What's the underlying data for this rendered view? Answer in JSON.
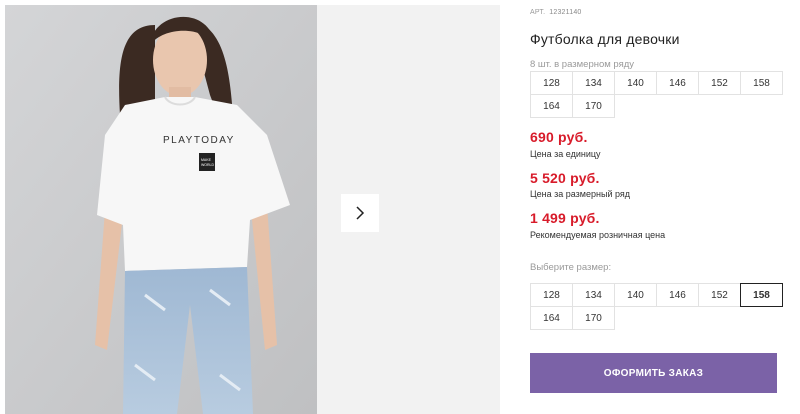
{
  "gallery": {
    "photo_alt": "product-photo",
    "shirt_print_text": "PLAYTODAY",
    "shirt_badge_lines": [
      "MAKE",
      "WORLD"
    ],
    "next_icon": "chevron-right-icon"
  },
  "product": {
    "article_label": "АРТ.",
    "article_value": "12321140",
    "title": "Футболка для девочки"
  },
  "pack": {
    "caption": "8 шт. в размерном ряду",
    "sizes": [
      "128",
      "134",
      "140",
      "146",
      "152",
      "158",
      "164",
      "170"
    ]
  },
  "prices": [
    {
      "value": "690 руб.",
      "label": "Цена за единицу"
    },
    {
      "value": "5 520 руб.",
      "label": "Цена за размерный ряд"
    },
    {
      "value": "1 499 руб.",
      "label": "Рекомендуемая розничная цена"
    }
  ],
  "size_select": {
    "caption": "Выберите размер:",
    "sizes": [
      "128",
      "134",
      "140",
      "146",
      "152",
      "158",
      "164",
      "170"
    ],
    "selected": "158"
  },
  "order_button": {
    "label": "ОФОРМИТЬ ЗАКАЗ"
  },
  "colors": {
    "price": "#d81b2a",
    "button": "#7b62a7"
  }
}
